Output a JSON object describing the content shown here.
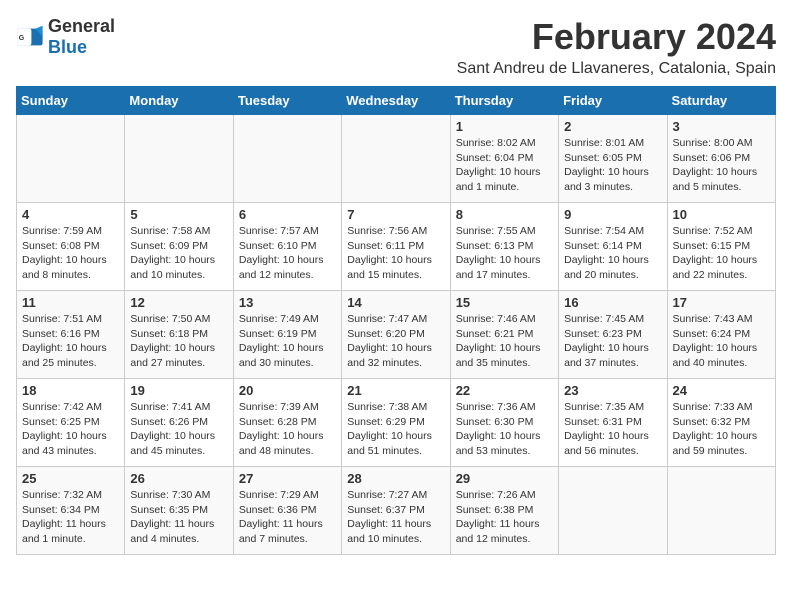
{
  "header": {
    "logo_general": "General",
    "logo_blue": "Blue",
    "month_title": "February 2024",
    "location": "Sant Andreu de Llavaneres, Catalonia, Spain"
  },
  "columns": [
    "Sunday",
    "Monday",
    "Tuesday",
    "Wednesday",
    "Thursday",
    "Friday",
    "Saturday"
  ],
  "rows": [
    [
      {
        "day": "",
        "info": ""
      },
      {
        "day": "",
        "info": ""
      },
      {
        "day": "",
        "info": ""
      },
      {
        "day": "",
        "info": ""
      },
      {
        "day": "1",
        "info": "Sunrise: 8:02 AM\nSunset: 6:04 PM\nDaylight: 10 hours and 1 minute."
      },
      {
        "day": "2",
        "info": "Sunrise: 8:01 AM\nSunset: 6:05 PM\nDaylight: 10 hours and 3 minutes."
      },
      {
        "day": "3",
        "info": "Sunrise: 8:00 AM\nSunset: 6:06 PM\nDaylight: 10 hours and 5 minutes."
      }
    ],
    [
      {
        "day": "4",
        "info": "Sunrise: 7:59 AM\nSunset: 6:08 PM\nDaylight: 10 hours and 8 minutes."
      },
      {
        "day": "5",
        "info": "Sunrise: 7:58 AM\nSunset: 6:09 PM\nDaylight: 10 hours and 10 minutes."
      },
      {
        "day": "6",
        "info": "Sunrise: 7:57 AM\nSunset: 6:10 PM\nDaylight: 10 hours and 12 minutes."
      },
      {
        "day": "7",
        "info": "Sunrise: 7:56 AM\nSunset: 6:11 PM\nDaylight: 10 hours and 15 minutes."
      },
      {
        "day": "8",
        "info": "Sunrise: 7:55 AM\nSunset: 6:13 PM\nDaylight: 10 hours and 17 minutes."
      },
      {
        "day": "9",
        "info": "Sunrise: 7:54 AM\nSunset: 6:14 PM\nDaylight: 10 hours and 20 minutes."
      },
      {
        "day": "10",
        "info": "Sunrise: 7:52 AM\nSunset: 6:15 PM\nDaylight: 10 hours and 22 minutes."
      }
    ],
    [
      {
        "day": "11",
        "info": "Sunrise: 7:51 AM\nSunset: 6:16 PM\nDaylight: 10 hours and 25 minutes."
      },
      {
        "day": "12",
        "info": "Sunrise: 7:50 AM\nSunset: 6:18 PM\nDaylight: 10 hours and 27 minutes."
      },
      {
        "day": "13",
        "info": "Sunrise: 7:49 AM\nSunset: 6:19 PM\nDaylight: 10 hours and 30 minutes."
      },
      {
        "day": "14",
        "info": "Sunrise: 7:47 AM\nSunset: 6:20 PM\nDaylight: 10 hours and 32 minutes."
      },
      {
        "day": "15",
        "info": "Sunrise: 7:46 AM\nSunset: 6:21 PM\nDaylight: 10 hours and 35 minutes."
      },
      {
        "day": "16",
        "info": "Sunrise: 7:45 AM\nSunset: 6:23 PM\nDaylight: 10 hours and 37 minutes."
      },
      {
        "day": "17",
        "info": "Sunrise: 7:43 AM\nSunset: 6:24 PM\nDaylight: 10 hours and 40 minutes."
      }
    ],
    [
      {
        "day": "18",
        "info": "Sunrise: 7:42 AM\nSunset: 6:25 PM\nDaylight: 10 hours and 43 minutes."
      },
      {
        "day": "19",
        "info": "Sunrise: 7:41 AM\nSunset: 6:26 PM\nDaylight: 10 hours and 45 minutes."
      },
      {
        "day": "20",
        "info": "Sunrise: 7:39 AM\nSunset: 6:28 PM\nDaylight: 10 hours and 48 minutes."
      },
      {
        "day": "21",
        "info": "Sunrise: 7:38 AM\nSunset: 6:29 PM\nDaylight: 10 hours and 51 minutes."
      },
      {
        "day": "22",
        "info": "Sunrise: 7:36 AM\nSunset: 6:30 PM\nDaylight: 10 hours and 53 minutes."
      },
      {
        "day": "23",
        "info": "Sunrise: 7:35 AM\nSunset: 6:31 PM\nDaylight: 10 hours and 56 minutes."
      },
      {
        "day": "24",
        "info": "Sunrise: 7:33 AM\nSunset: 6:32 PM\nDaylight: 10 hours and 59 minutes."
      }
    ],
    [
      {
        "day": "25",
        "info": "Sunrise: 7:32 AM\nSunset: 6:34 PM\nDaylight: 11 hours and 1 minute."
      },
      {
        "day": "26",
        "info": "Sunrise: 7:30 AM\nSunset: 6:35 PM\nDaylight: 11 hours and 4 minutes."
      },
      {
        "day": "27",
        "info": "Sunrise: 7:29 AM\nSunset: 6:36 PM\nDaylight: 11 hours and 7 minutes."
      },
      {
        "day": "28",
        "info": "Sunrise: 7:27 AM\nSunset: 6:37 PM\nDaylight: 11 hours and 10 minutes."
      },
      {
        "day": "29",
        "info": "Sunrise: 7:26 AM\nSunset: 6:38 PM\nDaylight: 11 hours and 12 minutes."
      },
      {
        "day": "",
        "info": ""
      },
      {
        "day": "",
        "info": ""
      }
    ]
  ]
}
